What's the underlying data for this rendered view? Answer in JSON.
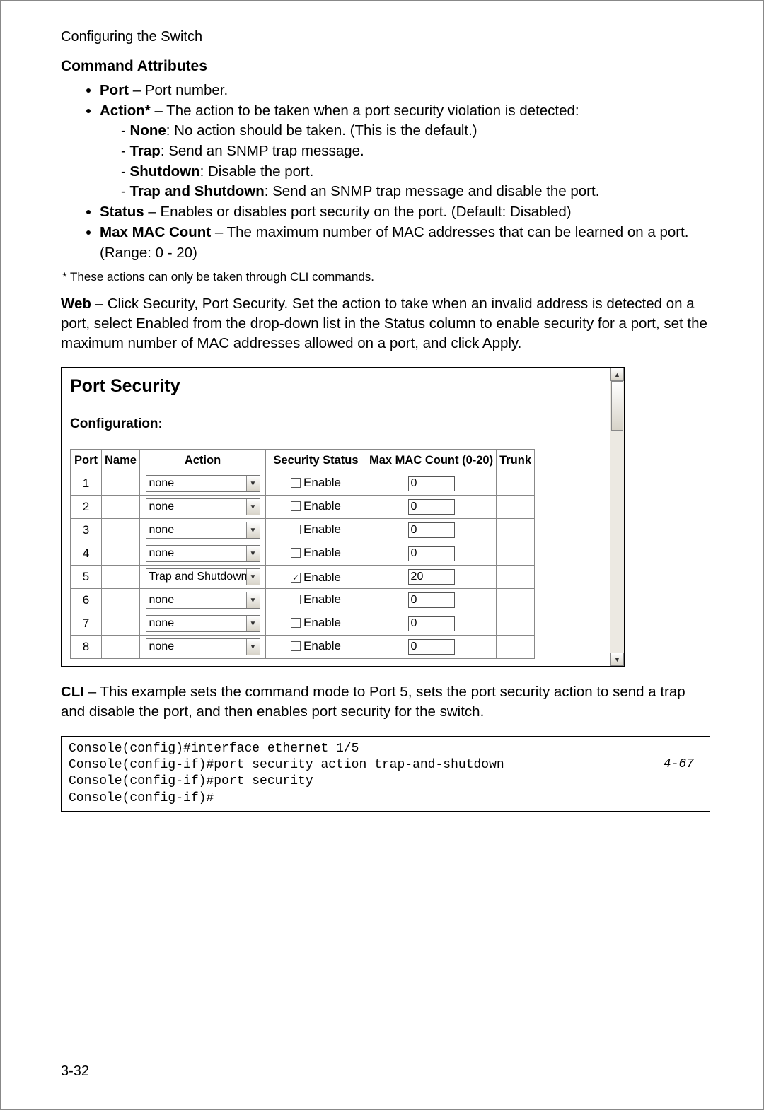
{
  "header": "Configuring the Switch",
  "section_title": "Command Attributes",
  "attrs": {
    "port_label": "Port",
    "port_desc": " – Port number.",
    "action_label": "Action*",
    "action_desc": " – The action to be taken when a port security violation is detected:",
    "action_none_label": "None",
    "action_none_desc": ": No action should be taken. (This is the default.)",
    "action_trap_label": "Trap",
    "action_trap_desc": ": Send an SNMP trap message.",
    "action_shutdown_label": "Shutdown",
    "action_shutdown_desc": ": Disable the port.",
    "action_ts_label": "Trap and Shutdown",
    "action_ts_desc": ": Send an SNMP trap message and disable the port.",
    "status_label": "Status",
    "status_desc": " – Enables or disables port security on the port. (Default: Disabled)",
    "mac_label": "Max MAC Count",
    "mac_desc": " – The maximum number of MAC addresses that can be learned on a port. (Range: 0 - 20)"
  },
  "footnote": "* These actions can only be taken through CLI commands.",
  "web_label": "Web",
  "web_desc": " – Click Security, Port Security. Set the action to take when an invalid address is detected on a port, select Enabled from the drop-down list in the Status column to enable security for a port, set the maximum number of MAC addresses allowed on a port, and click Apply.",
  "panel": {
    "title": "Port Security",
    "subtitle": "Configuration:",
    "headers": {
      "port": "Port",
      "name": "Name",
      "action": "Action",
      "status": "Security Status",
      "mac": "Max MAC Count (0-20)",
      "trunk": "Trunk"
    },
    "enable_label": "Enable",
    "rows": [
      {
        "port": "1",
        "name": "",
        "action": "none",
        "checked": false,
        "mac": "0",
        "trunk": ""
      },
      {
        "port": "2",
        "name": "",
        "action": "none",
        "checked": false,
        "mac": "0",
        "trunk": ""
      },
      {
        "port": "3",
        "name": "",
        "action": "none",
        "checked": false,
        "mac": "0",
        "trunk": ""
      },
      {
        "port": "4",
        "name": "",
        "action": "none",
        "checked": false,
        "mac": "0",
        "trunk": ""
      },
      {
        "port": "5",
        "name": "",
        "action": "Trap and Shutdown",
        "checked": true,
        "mac": "20",
        "trunk": ""
      },
      {
        "port": "6",
        "name": "",
        "action": "none",
        "checked": false,
        "mac": "0",
        "trunk": ""
      },
      {
        "port": "7",
        "name": "",
        "action": "none",
        "checked": false,
        "mac": "0",
        "trunk": ""
      },
      {
        "port": "8",
        "name": "",
        "action": "none",
        "checked": false,
        "mac": "0",
        "trunk": ""
      }
    ]
  },
  "cli_label": "CLI",
  "cli_desc": " – This example sets the command mode to Port 5, sets the port security action to send a trap and disable the port, and then enables port security for the switch.",
  "cli_lines": "Console(config)#interface ethernet 1/5\nConsole(config-if)#port security action trap-and-shutdown\nConsole(config-if)#port security\nConsole(config-if)#",
  "cli_ref": "4-67",
  "page_number": "3-32"
}
